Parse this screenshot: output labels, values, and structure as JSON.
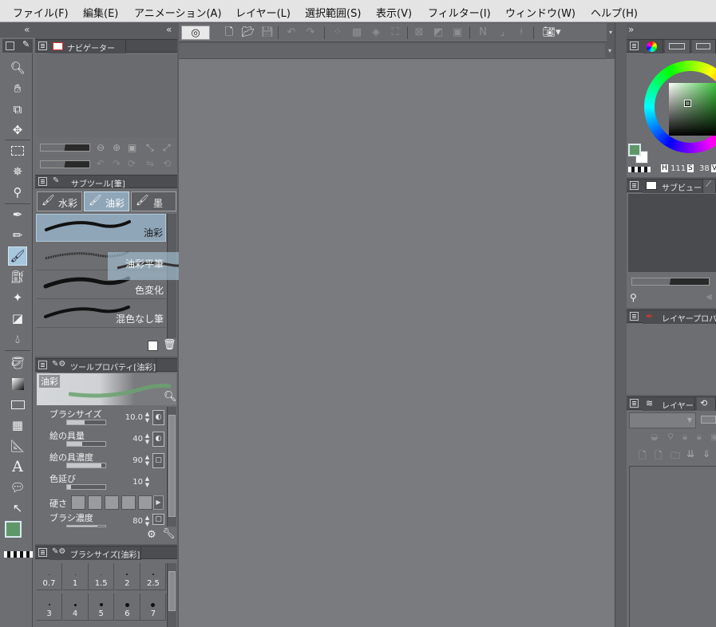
{
  "menu": [
    "ファイル(F)",
    "編集(E)",
    "アニメーション(A)",
    "レイヤー(L)",
    "選択範囲(S)",
    "表示(V)",
    "フィルター(I)",
    "ウィンドウ(W)",
    "ヘルプ(H)"
  ],
  "panels": {
    "navigator": {
      "title": "ナビゲーター"
    },
    "subtool": {
      "title": "サブツール[筆]",
      "tabs": [
        "水彩",
        "油彩",
        "墨"
      ],
      "brushes": [
        "油彩",
        "油彩平筆",
        "色変化",
        "混色なし筆"
      ],
      "drag_ghost": {
        "name": "油彩平筆",
        "group": "油彩"
      }
    },
    "tool_property": {
      "title": "ツールプロパティ[油彩]",
      "preview_label": "油彩",
      "props": [
        {
          "label": "ブラシサイズ",
          "value": "10.0",
          "level": 0.45
        },
        {
          "label": "絵の具量",
          "value": "40",
          "level": 0.4
        },
        {
          "label": "絵の具濃度",
          "value": "90",
          "level": 0.9
        },
        {
          "label": "色延び",
          "value": "10",
          "level": 0.1
        },
        {
          "label": "硬さ",
          "value": "",
          "level": 0
        },
        {
          "label": "ブラシ濃度",
          "value": "80",
          "level": 0.8
        }
      ]
    },
    "brush_size": {
      "title": "ブラシサイズ[油彩]",
      "sizes": [
        "0.7",
        "1",
        "1.5",
        "2",
        "2.5",
        "3",
        "4",
        "5",
        "6",
        "7"
      ]
    },
    "color": {
      "h_label": "H",
      "h_value": "111",
      "s_label": "S",
      "s_value": "38",
      "v_label": "V"
    },
    "subview": {
      "title": "サブビュー"
    },
    "layer_property": {
      "title": "レイヤープロパ"
    },
    "layer": {
      "title": "レイヤー"
    }
  },
  "colors": {
    "main_color": "#5f9868",
    "sub_color": "#ffffff",
    "selection": "#a7c7dd"
  },
  "toolbar_icons": [
    "zoom-icon",
    "hand-icon",
    "rotate-icon",
    "move-layer-icon",
    "selection-icon",
    "auto-select-icon",
    "eyedropper-icon",
    "pen-icon",
    "pencil-icon",
    "brush-icon",
    "airbrush-icon",
    "decoration-icon",
    "eraser-icon",
    "blend-icon",
    "fill-icon",
    "gradient-icon",
    "figure-icon",
    "frame-icon",
    "ruler-icon",
    "text-icon",
    "balloon-icon",
    "correct-line-icon"
  ]
}
